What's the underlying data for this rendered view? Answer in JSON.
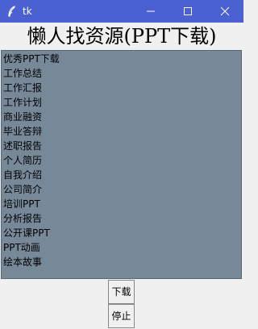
{
  "window": {
    "title": "tk",
    "app_icon": "feather-icon",
    "controls": [
      "minimize-icon",
      "maximize-icon",
      "close-icon"
    ]
  },
  "heading": "懒人找资源(PPT下载)",
  "list": {
    "items": [
      "优秀PPT下载",
      "工作总结",
      "工作汇报",
      "工作计划",
      "商业融资",
      "毕业答辩",
      "述职报告",
      "个人简历",
      "自我介绍",
      "公司简介",
      "培训PPT",
      "分析报告",
      "公开课PPT",
      "PPT动画",
      "绘本故事"
    ],
    "background": "#778899"
  },
  "buttons": {
    "download": "下载",
    "stop": "停止"
  },
  "colors": {
    "titlebar": "#4b61d1",
    "window_bg": "#f0f0f0"
  }
}
